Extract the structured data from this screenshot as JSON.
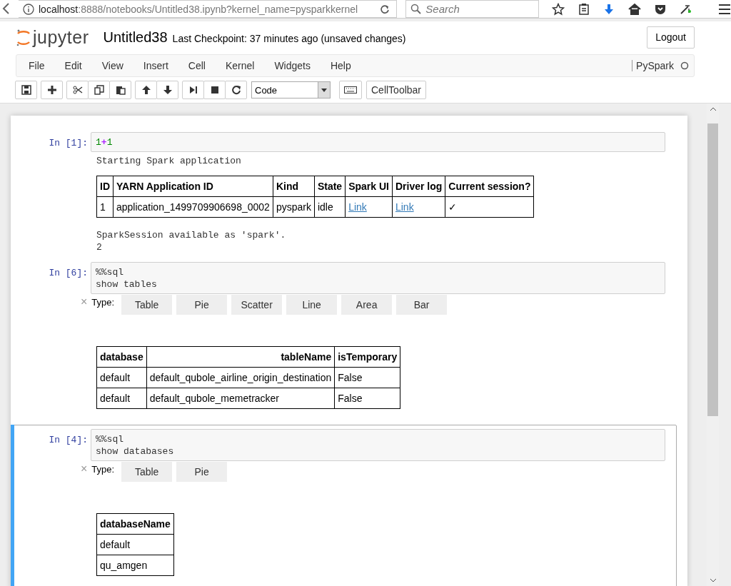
{
  "browser": {
    "url_host": "localhost",
    "url_path": ":8888/notebooks/Untitled38.ipynb?kernel_name=pysparkkernel",
    "search_placeholder": "Search"
  },
  "header": {
    "logo": "jupyter",
    "title": "Untitled38",
    "checkpoint": "Last Checkpoint: 37 minutes ago (unsaved changes)",
    "logout": "Logout"
  },
  "menu": [
    "File",
    "Edit",
    "View",
    "Insert",
    "Cell",
    "Kernel",
    "Widgets",
    "Help"
  ],
  "kernel": {
    "name": "PySpark",
    "busy": false
  },
  "toolbar": {
    "cell_type": "Code",
    "celltoolbar": "CellToolbar"
  },
  "cells": [
    {
      "prompt": "In [1]:",
      "selected": false,
      "source": [
        [
          {
            "text": "1",
            "kind": "number"
          },
          {
            "text": "+",
            "kind": "operator"
          },
          {
            "text": "1",
            "kind": "number"
          }
        ]
      ],
      "outputs": [
        {
          "kind": "text",
          "text": "Starting Spark application"
        },
        {
          "kind": "table",
          "columns": [
            {
              "label": "ID"
            },
            {
              "label": "YARN Application ID"
            },
            {
              "label": "Kind"
            },
            {
              "label": "State"
            },
            {
              "label": "Spark UI"
            },
            {
              "label": "Driver log"
            },
            {
              "label": "Current session?"
            }
          ],
          "rows": [
            [
              {
                "text": "1"
              },
              {
                "text": "application_1499709906698_0002"
              },
              {
                "text": "pyspark"
              },
              {
                "text": "idle"
              },
              {
                "text": "Link",
                "kind": "link"
              },
              {
                "text": "Link",
                "kind": "link"
              },
              {
                "text": "✓"
              }
            ]
          ]
        },
        {
          "kind": "text",
          "text": "SparkSession available as 'spark'."
        },
        {
          "kind": "text",
          "text": "2"
        }
      ]
    },
    {
      "prompt": "In [6]:",
      "selected": false,
      "source": [
        [
          {
            "text": "%%sql",
            "kind": "plain"
          }
        ],
        [
          {
            "text": "show tables",
            "kind": "plain"
          }
        ]
      ],
      "outputs": [
        {
          "kind": "widget",
          "close": "×",
          "type_label": "Type:",
          "buttons": [
            "Table",
            "Pie",
            "Scatter",
            "Line",
            "Area",
            "Bar"
          ]
        },
        {
          "kind": "table",
          "columns": [
            {
              "label": "database"
            },
            {
              "label": "tableName",
              "right_aligned": true
            },
            {
              "label": "isTemporary"
            }
          ],
          "rows": [
            [
              {
                "text": "default"
              },
              {
                "text": "default_qubole_airline_origin_destination"
              },
              {
                "text": "False"
              }
            ],
            [
              {
                "text": "default"
              },
              {
                "text": "default_qubole_memetracker"
              },
              {
                "text": "False"
              }
            ]
          ]
        }
      ]
    },
    {
      "prompt": "In [4]:",
      "selected": true,
      "source": [
        [
          {
            "text": "%%sql",
            "kind": "plain"
          }
        ],
        [
          {
            "text": "show databases",
            "kind": "plain"
          }
        ]
      ],
      "outputs": [
        {
          "kind": "widget",
          "close": "×",
          "type_label": "Type:",
          "buttons": [
            "Table",
            "Pie"
          ]
        },
        {
          "kind": "table",
          "columns": [
            {
              "label": "databaseName"
            }
          ],
          "rows": [
            [
              {
                "text": "default"
              }
            ],
            [
              {
                "text": "qu_amgen"
              }
            ]
          ]
        }
      ]
    }
  ]
}
